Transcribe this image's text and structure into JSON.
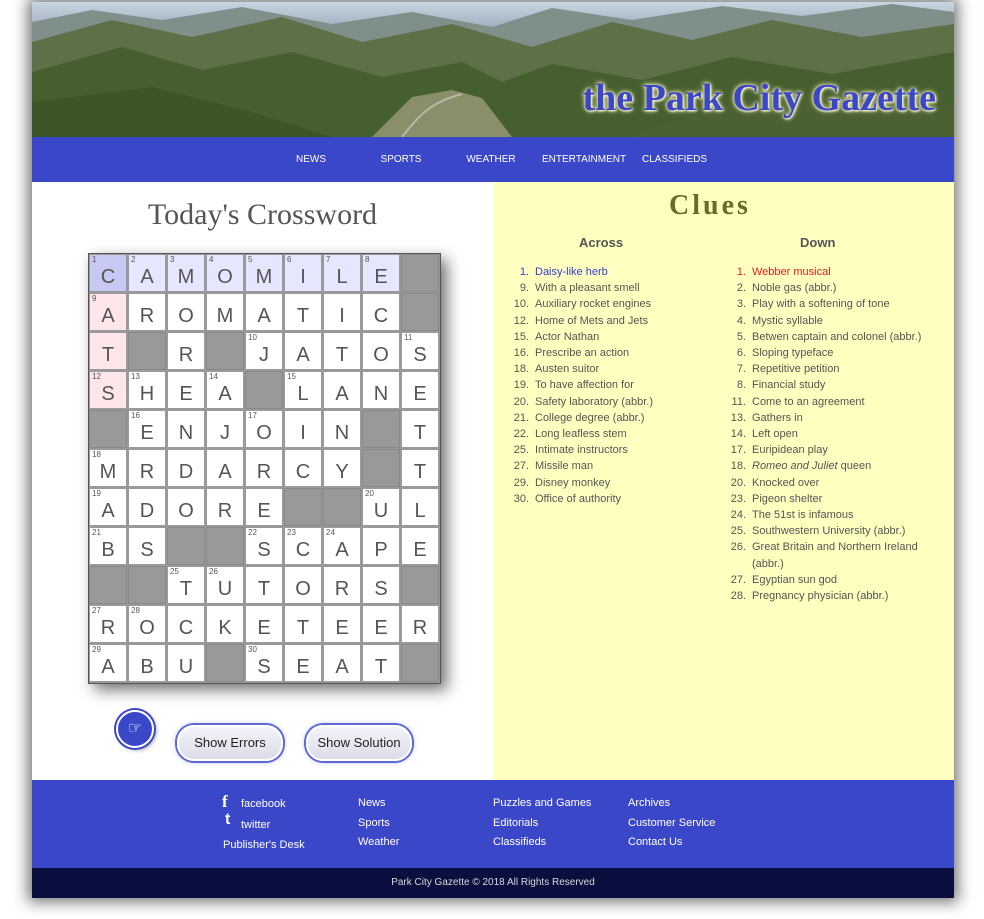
{
  "header": {
    "brand": "the Park City Gazette"
  },
  "nav": [
    "NEWS",
    "SPORTS",
    "WEATHER",
    "ENTERTAINMENT",
    "CLASSIFIEDS"
  ],
  "crossword": {
    "title": "Today's Crossword",
    "grid": [
      [
        "C",
        "A",
        "M",
        "O",
        "M",
        "I",
        "L",
        "E",
        "#"
      ],
      [
        "A",
        "R",
        "O",
        "M",
        "A",
        "T",
        "I",
        "C",
        "#"
      ],
      [
        "T",
        "#",
        "R",
        "#",
        "J",
        "A",
        "T",
        "O",
        "S"
      ],
      [
        "S",
        "H",
        "E",
        "A",
        "#",
        "L",
        "A",
        "N",
        "E"
      ],
      [
        "#",
        "E",
        "N",
        "J",
        "O",
        "I",
        "N",
        "#",
        "T"
      ],
      [
        "M",
        "R",
        "D",
        "A",
        "R",
        "C",
        "Y",
        "#",
        "T"
      ],
      [
        "A",
        "D",
        "O",
        "R",
        "E",
        "#",
        "#",
        "U",
        "L"
      ],
      [
        "B",
        "S",
        "#",
        "#",
        "S",
        "C",
        "A",
        "P",
        "E"
      ],
      [
        "#",
        "#",
        "T",
        "U",
        "T",
        "O",
        "R",
        "S",
        "#"
      ],
      [
        "R",
        "O",
        "C",
        "K",
        "E",
        "T",
        "E",
        "E",
        "R"
      ],
      [
        "A",
        "B",
        "U",
        "#",
        "S",
        "E",
        "A",
        "T",
        "#"
      ]
    ],
    "show_errors_label": "Show Errors",
    "show_solution_label": "Show Solution",
    "hint_icon": "pointing-hand-icon"
  },
  "clues": {
    "title": "Clues",
    "across_title": "Across",
    "down_title": "Down",
    "across": [
      {
        "n": "1.",
        "t": "Daisy-like herb"
      },
      {
        "n": "9.",
        "t": "With a pleasant smell"
      },
      {
        "n": "10.",
        "t": "Auxiliary rocket engines"
      },
      {
        "n": "12.",
        "t": "Home of Mets and Jets"
      },
      {
        "n": "15.",
        "t": "Actor Nathan"
      },
      {
        "n": "16.",
        "t": "Prescribe an action"
      },
      {
        "n": "18.",
        "t": "Austen suitor"
      },
      {
        "n": "19.",
        "t": "To have affection for"
      },
      {
        "n": "20.",
        "t": "Safety laboratory (abbr.)"
      },
      {
        "n": "21.",
        "t": "College degree (abbr.)"
      },
      {
        "n": "22.",
        "t": "Long leafless stem"
      },
      {
        "n": "25.",
        "t": "Intimate instructors"
      },
      {
        "n": "27.",
        "t": "Missile man"
      },
      {
        "n": "29.",
        "t": "Disney monkey"
      },
      {
        "n": "30.",
        "t": "Office of authority"
      }
    ],
    "down": [
      {
        "n": "1.",
        "t": "Webber musical"
      },
      {
        "n": "2.",
        "t": "Noble gas (abbr.)"
      },
      {
        "n": "3.",
        "t": "Play with a softening of tone"
      },
      {
        "n": "4.",
        "t": "Mystic syllable"
      },
      {
        "n": "5.",
        "t": "Betwen captain and colonel (abbr.)"
      },
      {
        "n": "6.",
        "t": "Sloping typeface"
      },
      {
        "n": "7.",
        "t": "Repetitive petition"
      },
      {
        "n": "8.",
        "t": "Financial study"
      },
      {
        "n": "11.",
        "t": "Come to an agreement"
      },
      {
        "n": "13.",
        "t": "Gathers in"
      },
      {
        "n": "14.",
        "t": "Left open"
      },
      {
        "n": "17.",
        "t": "Euripidean play"
      },
      {
        "n": "18.",
        "t": "Romeo and Juliet queen"
      },
      {
        "n": "20.",
        "t": "Knocked over"
      },
      {
        "n": "23.",
        "t": "Pigeon shelter"
      },
      {
        "n": "24.",
        "t": "The 51st is infamous"
      },
      {
        "n": "25.",
        "t": "Southwestern University (abbr.)"
      },
      {
        "n": "26.",
        "t": "Great Britain and Northern Ireland (abbr.)"
      },
      {
        "n": "27.",
        "t": "Egyptian sun god"
      },
      {
        "n": "28.",
        "t": "Pregnancy physician (abbr.)"
      }
    ]
  },
  "footer": {
    "facebook": "facebook",
    "twitter": "twitter",
    "facebook_icon": "f",
    "twitter_icon": "t",
    "publishers_desk": "Publisher's Desk",
    "col2": [
      "News",
      "Sports",
      "Weather"
    ],
    "col3": [
      "Puzzles and Games",
      "Editorials",
      "Classifieds"
    ],
    "col4": [
      "Archives",
      "Customer Service",
      "Contact Us"
    ],
    "copyright": "Park City Gazette © 2018 All Rights Reserved"
  }
}
